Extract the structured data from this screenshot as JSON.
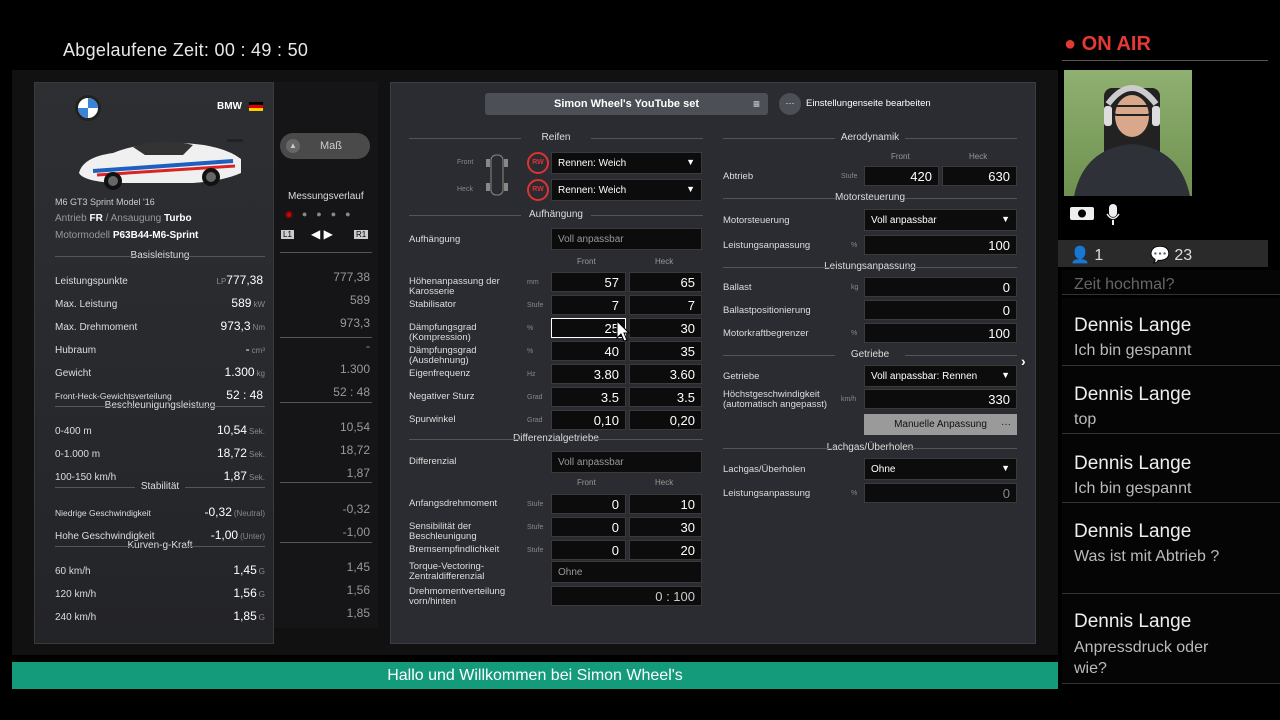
{
  "stream": {
    "elapsed_label": "Abgelaufene Zeit:",
    "elapsed_time": "00 : 49 : 50",
    "on_air": "ON AIR",
    "viewers": "1",
    "messages": "23",
    "banner": "Hallo und Willkommen bei Simon Wheel's"
  },
  "car": {
    "brand": "BMW",
    "model": "M6 GT3 Sprint Model '16",
    "drive_label": "Antrieb",
    "drive": "FR",
    "aspiration_label": "Ansaugung",
    "aspiration": "Turbo",
    "engine_label": "Motormodell",
    "engine": "P63B44-M6-Sprint"
  },
  "sections": {
    "basic": "Basisleistung",
    "accel": "Beschleunigungsleistung",
    "stability": "Stabilität",
    "curve": "Kurven-g-Kraft"
  },
  "stats": [
    {
      "label": "Leistungspunkte",
      "pre": "LP",
      "value": "777,38",
      "unit": "",
      "ghost": "777,38"
    },
    {
      "label": "Max. Leistung",
      "pre": "",
      "value": "589",
      "unit": "kW",
      "ghost": "589"
    },
    {
      "label": "Max. Drehmoment",
      "pre": "",
      "value": "973,3",
      "unit": "Nm",
      "ghost": "973,3"
    },
    {
      "label": "Hubraum",
      "pre": "",
      "value": "-",
      "unit": "cm³",
      "ghost": "-"
    },
    {
      "label": "Gewicht",
      "pre": "",
      "value": "1.300",
      "unit": "kg",
      "ghost": "1.300"
    },
    {
      "label": "Front-Heck-Gewichtsverteilung",
      "pre": "",
      "value": "52 : 48",
      "unit": "",
      "ghost": "52 : 48"
    },
    {
      "label": "0-400 m",
      "pre": "",
      "value": "10,54",
      "unit": "Sek.",
      "ghost": "10,54"
    },
    {
      "label": "0-1.000 m",
      "pre": "",
      "value": "18,72",
      "unit": "Sek.",
      "ghost": "18,72"
    },
    {
      "label": "100-150 km/h",
      "pre": "",
      "value": "1,87",
      "unit": "Sek.",
      "ghost": "1,87"
    },
    {
      "label": "Niedrige Geschwindigkeit",
      "pre": "",
      "value": "-0,32",
      "unit": "(Neutral)",
      "ghost": "-0,32"
    },
    {
      "label": "Hohe Geschwindigkeit",
      "pre": "",
      "value": "-1,00",
      "unit": "(Unter)",
      "ghost": "-1,00"
    },
    {
      "label": "60 km/h",
      "pre": "",
      "value": "1,45",
      "unit": "G",
      "ghost": "1,45"
    },
    {
      "label": "120 km/h",
      "pre": "",
      "value": "1,56",
      "unit": "G",
      "ghost": "1,56"
    },
    {
      "label": "240 km/h",
      "pre": "",
      "value": "1,85",
      "unit": "G",
      "ghost": "1,85"
    }
  ],
  "ghost": {
    "button": "Maß",
    "history": "Messungsverlauf",
    "l1": "L1",
    "r1": "R1"
  },
  "setup": {
    "name": "Simon Wheel's YouTube set",
    "edit": "Einstellungenseite bearbeiten",
    "edit_icon": "···"
  },
  "tires": {
    "title": "Reifen",
    "front_label": "Front",
    "rear_label": "Heck",
    "badge": "RW",
    "front": "Rennen: Weich",
    "rear": "Rennen: Weich"
  },
  "susp": {
    "title": "Aufhängung",
    "label": "Aufhängung",
    "value": "Voll anpassbar",
    "col_front": "Front",
    "col_rear": "Heck",
    "rows": [
      {
        "label": "Höhenanpassung der Karosserie",
        "unit": "mm",
        "front": "57",
        "rear": "65"
      },
      {
        "label": "Stabilisator",
        "unit": "Stufe",
        "front": "7",
        "rear": "7"
      },
      {
        "label": "Dämpfungsgrad (Kompression)",
        "unit": "%",
        "front": "25",
        "rear": "30"
      },
      {
        "label": "Dämpfungsgrad (Ausdehnung)",
        "unit": "%",
        "front": "40",
        "rear": "35"
      },
      {
        "label": "Eigenfrequenz",
        "unit": "Hz",
        "front": "3.80",
        "rear": "3.60"
      },
      {
        "label": "Negativer Sturz",
        "unit": "Grad",
        "front": "3.5",
        "rear": "3.5"
      },
      {
        "label": "Spurwinkel",
        "unit": "Grad",
        "front": "0,10",
        "rear": "0,20"
      }
    ]
  },
  "diff": {
    "title": "Differenzialgetriebe",
    "label": "Differenzial",
    "value": "Voll anpassbar",
    "col_front": "Front",
    "col_rear": "Heck",
    "rows": [
      {
        "label": "Anfangsdrehmoment",
        "unit": "Stufe",
        "front": "0",
        "rear": "10"
      },
      {
        "label": "Sensibilität der Beschleunigung",
        "unit": "Stufe",
        "front": "0",
        "rear": "30"
      },
      {
        "label": "Bremsempfindlichkeit",
        "unit": "Stufe",
        "front": "0",
        "rear": "20"
      }
    ],
    "tv_label": "Torque-Vectoring-Zentraldifferenzial",
    "tv_value": "Ohne",
    "dist_label": "Drehmomentverteilung vorn/hinten",
    "dist_value": "0 : 100"
  },
  "aero": {
    "title": "Aerodynamik",
    "col_front": "Front",
    "col_rear": "Heck",
    "label": "Abtrieb",
    "unit": "Stufe",
    "front": "420",
    "rear": "630"
  },
  "ecu": {
    "title": "Motorsteuerung",
    "label": "Motorsteuerung",
    "value": "Voll anpassbar",
    "power_label": "Leistungsanpassung",
    "unit": "%",
    "power": "100"
  },
  "perf": {
    "title": "Leistungsanpassung",
    "ballast_label": "Ballast",
    "ballast_unit": "kg",
    "ballast": "0",
    "pos_label": "Ballastpositionierung",
    "pos": "0",
    "limit_label": "Motorkraftbegrenzer",
    "limit_unit": "%",
    "limit": "100"
  },
  "trans": {
    "title": "Getriebe",
    "label": "Getriebe",
    "value": "Voll anpassbar: Rennen",
    "top_label": "Höchstgeschwindigkeit (automatisch angepasst)",
    "top_unit": "km/h",
    "top": "330",
    "manual": "Manuelle Anpassung"
  },
  "nitro": {
    "title": "Lachgas/Überholen",
    "label": "Lachgas/Überholen",
    "value": "Ohne",
    "power_label": "Leistungsanpassung",
    "unit": "%",
    "power": "0"
  },
  "chat": [
    {
      "name": "",
      "text": "Zeit hochmal?"
    },
    {
      "name": "Dennis Lange",
      "text": "Ich bin gespannt"
    },
    {
      "name": "Dennis Lange",
      "text": "top"
    },
    {
      "name": "Dennis Lange",
      "text": "Ich bin gespannt"
    },
    {
      "name": "Dennis Lange",
      "text": "Was ist mit Abtrieb ?"
    },
    {
      "name": "Dennis Lange",
      "text": "Anpressdruck oder wie?"
    }
  ]
}
